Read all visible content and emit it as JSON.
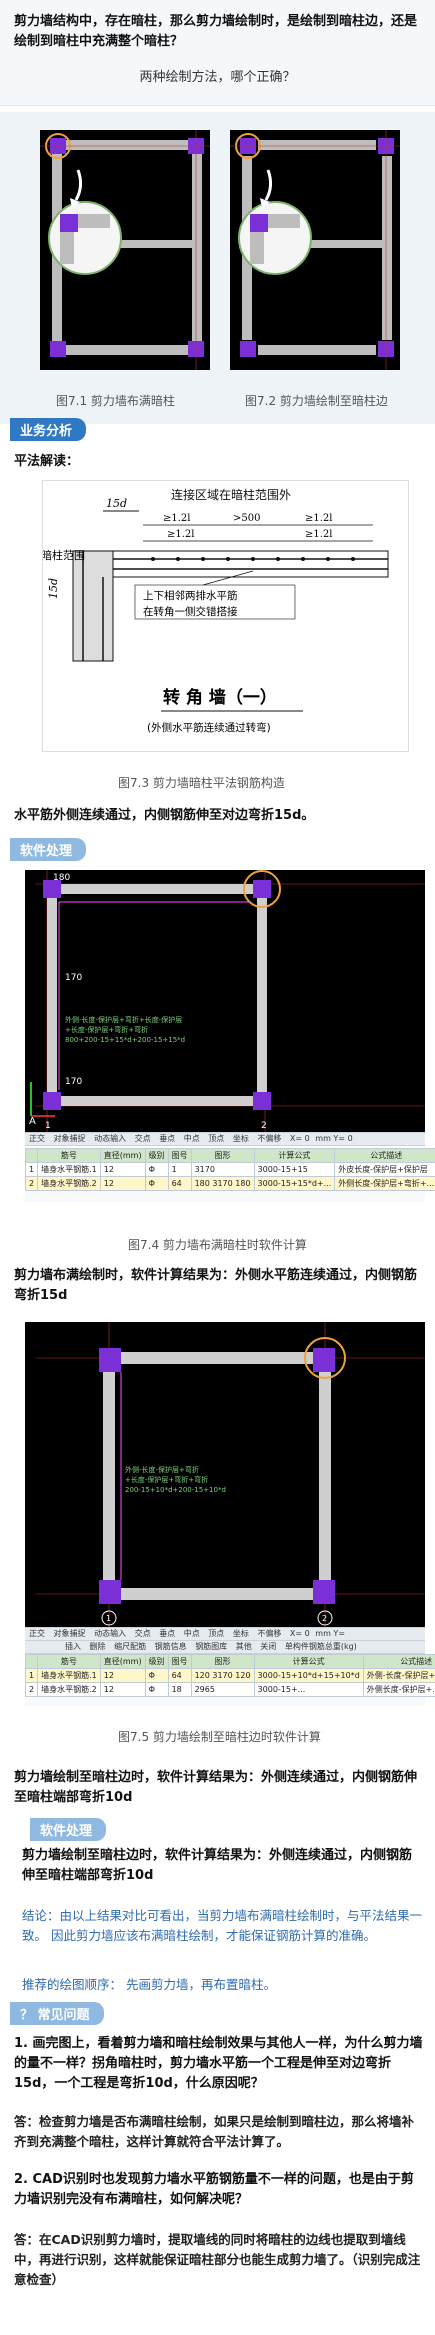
{
  "question": {
    "title": "剪力墙结构中，存在暗柱，那么剪力墙绘制时，是绘制到暗柱边，还是绘制到暗柱中充满整个暗柱？",
    "sub": "两种绘制方法，哪个正确？"
  },
  "fig71": {
    "caption": "图7.1  剪力墙布满暗柱"
  },
  "fig72": {
    "caption": "图7.2  剪力墙绘制至暗柱边"
  },
  "section_analysis": "业务分析",
  "flat_method": "平法解读：",
  "drawing": {
    "top_label": "连接区域在暗柱范围外",
    "dim_15d": "15d",
    "dims_row": [
      "≥1.2l<sub>aE</sub>",
      ">500",
      "≥1.2l<sub>aE</sub>"
    ],
    "dims_row2": [
      "≥1.2l<sub>aE</sub>",
      "≥1.2l<sub>aE</sub>"
    ],
    "column_range": "暗柱范围",
    "side_15d": "15d",
    "note1": "上下相邻两排水平筋",
    "note2": "在转角一侧交错搭接",
    "title": "转 角 墙（一）",
    "subtitle": "(外侧水平筋连续通过转弯)"
  },
  "fig73": {
    "caption": "图7.3  剪力墙暗柱平法钢筋构造"
  },
  "flat_result": "水平筋外侧连续通过，内侧钢筋伸至对边弯折15d。",
  "section_software": "软件处理",
  "cad1": {
    "top_value": "180",
    "mid_value": "170",
    "bottom_value": "170",
    "formula1": "外侧-长度-保护层+弯折+长度-保护层",
    "formula2": "+长度-保护层+弯折+弯折",
    "formula3": "800+200-15+15*d+200-15+15*d",
    "axis_a": "A",
    "axis_1": "1",
    "axis_2": "2"
  },
  "toolbar1": [
    "正交",
    "对象捕捉",
    "动态输入",
    "交点",
    "垂点",
    "中点",
    "顶点",
    "坐标",
    "不偏移",
    "X=",
    "0",
    "mm Y=",
    "0"
  ],
  "table1": {
    "headers": [
      "",
      "筋号",
      "直径(mm)",
      "级别",
      "图号",
      "图形",
      "计算公式",
      "公式描述"
    ],
    "rows": [
      [
        "1",
        "墙身水平钢筋.1",
        "12",
        "Φ",
        "1",
        "3170",
        "3000-15+15",
        "外皮长度-保护层+保护层"
      ],
      [
        "2",
        "墙身水平钢筋.2",
        "12",
        "Φ",
        "64",
        "180  3170  180",
        "3000-15+15*d+...",
        "外侧长度-保护层+弯折+..."
      ]
    ]
  },
  "fig74": {
    "caption": "图7.4  剪力墙布满暗柱时软件计算"
  },
  "result1": "剪力墙布满绘制时，软件计算结果为：外侧水平筋连续通过，内侧钢筋弯折15d",
  "cad2": {
    "formula1": "外侧-长度-保护层+弯折",
    "formula2": "+长度-保护层+弯折+弯折",
    "formula3": "200-15+10*d+200-15+10*d",
    "axis_1": "1",
    "axis_2": "2"
  },
  "toolbar2": [
    "正交",
    "对象捕捉",
    "动态输入",
    "交点",
    "垂点",
    "中点",
    "顶点",
    "坐标",
    "不偏移",
    "X=",
    "0",
    "mm Y="
  ],
  "toolbar2b": [
    "插入",
    "删除",
    "缩尺配筋",
    "钢筋信息",
    "钢筋图库",
    "其他",
    "关闭",
    "单构件钢筋总重(kg)"
  ],
  "table2": {
    "headers": [
      "",
      "筋号",
      "直径(mm)",
      "级别",
      "图号",
      "图形",
      "计算公式",
      "公式描述"
    ],
    "rows": [
      [
        "1",
        "墙身水平钢筋.1",
        "12",
        "Φ",
        "64",
        "120  3170  120",
        "3000-15+10*d+15+10*d",
        "外侧-长度-保护层+弯折+..."
      ],
      [
        "2",
        "墙身水平钢筋.2",
        "12",
        "Φ",
        "18",
        "2965",
        "3000-15+...",
        "外侧长度-保护层+..."
      ]
    ]
  },
  "fig75": {
    "caption": "图7.5  剪力墙绘制至暗柱边时软件计算"
  },
  "result2": "剪力墙绘制至暗柱边时，软件计算结果为：外侧连续通过，内侧钢筋伸至暗柱端部弯折10d",
  "section_software2": "软件处理",
  "result2_repeat": "剪力墙绘制至暗柱边时，软件计算结果为：外侧连续通过，内侧钢筋伸至暗柱端部弯折10d",
  "conclusion": "结论：由以上结果对比可看出，当剪力墙布满暗柱绘制时，与平法结果一致。 因此剪力墙应该布满暗柱绘制，才能保证钢筋计算的准确。",
  "recommend": "推荐的绘图顺序：  先画剪力墙，再布置暗柱。",
  "section_faq": "？ 常见问题",
  "faq1_q": "1.    画完图上，看着剪力墙和暗柱绘制效果与其他人一样，为什么剪力墙的量不一样？拐角暗柱时，剪力墙水平筋一个工程是伸至对边弯折15d，一个工程是弯折10d，什么原因呢？",
  "faq1_a": "答：检查剪力墙是否布满暗柱绘制，如果只是绘制到暗柱边，那么将墙补齐到充满整个暗柱，这样计算就符合平法计算了。",
  "faq2_q": "2.    CAD识别时也发现剪力墙水平筋钢筋量不一样的问题，也是由于剪力墙识别完没有布满暗柱，如何解决呢？",
  "faq2_a": "答：在CAD识别剪力墙时，提取墙线的同时将暗柱的边线也提取到墙线中，再进行识别，这样就能保证暗柱部分也能生成剪力墙了。（识别完成注意检查）",
  "colors": {
    "accent": "#2f78c4",
    "cad_purple": "#7b2fd6",
    "cad_wall": "#cfcfcf",
    "highlight_ring": "#f0a23c"
  }
}
